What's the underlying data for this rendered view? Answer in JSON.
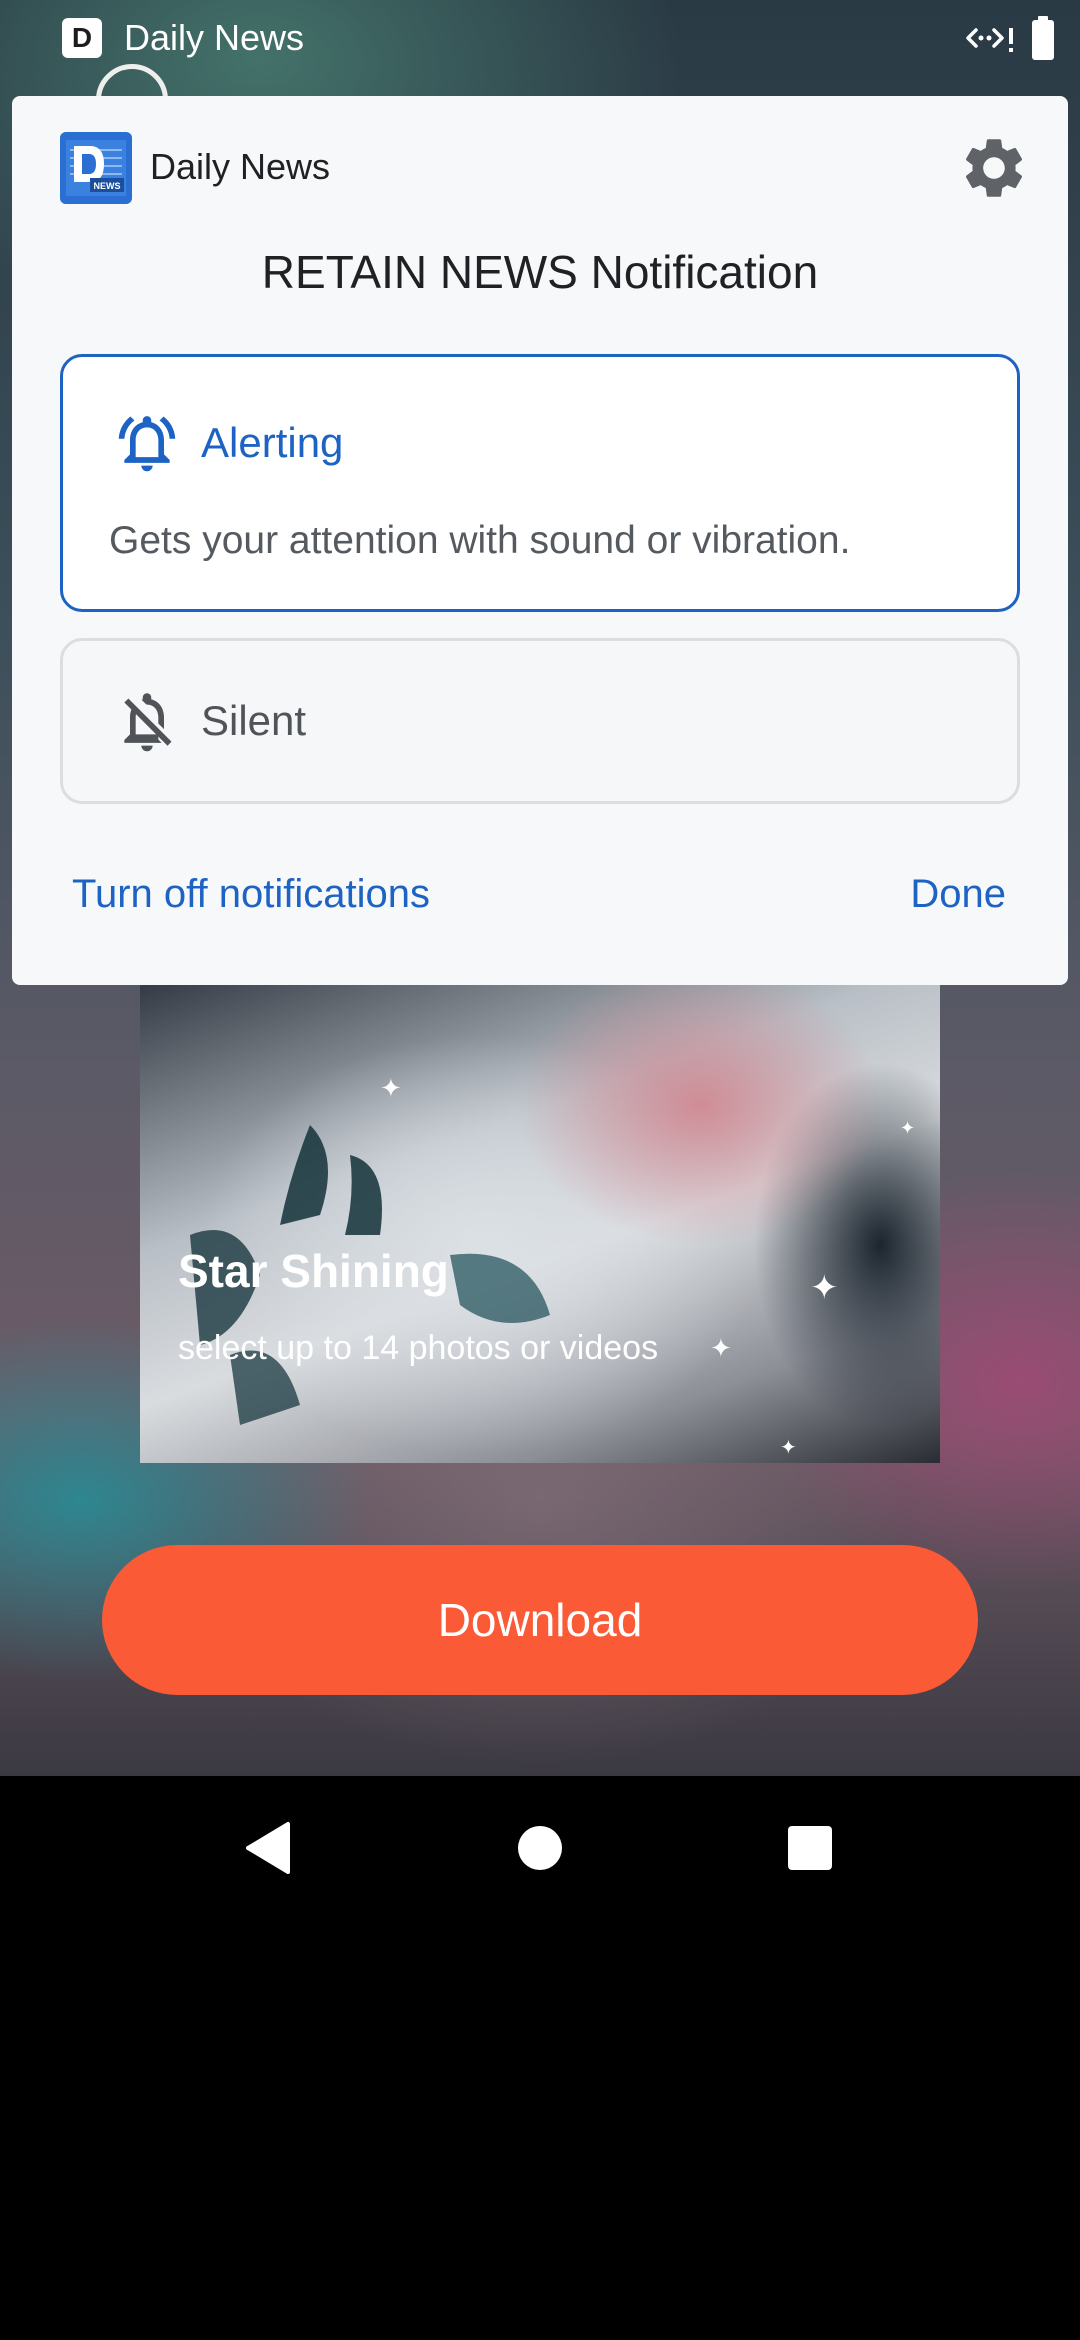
{
  "status_bar": {
    "app_icon_letter": "D",
    "app_name": "Daily News",
    "icons": [
      "data-arrows-icon",
      "battery-icon"
    ]
  },
  "panel": {
    "app_name": "Daily News",
    "app_icon_text": "NEWS",
    "title": "RETAIN NEWS Notification",
    "settings_icon": "gear-icon",
    "options": {
      "alerting": {
        "label": "Alerting",
        "description": "Gets your attention with sound or vibration.",
        "icon": "bell-ringing-icon",
        "selected": true
      },
      "silent": {
        "label": "Silent",
        "icon": "bell-off-icon",
        "selected": false
      }
    },
    "turn_off_label": "Turn off notifications",
    "done_label": "Done"
  },
  "ad": {
    "title": "Star Shining",
    "subtitle": "select up to 14 photos or videos",
    "download_label": "Download",
    "download_color": "#fa5a35"
  },
  "colors": {
    "accent": "#1d63c4",
    "panel_bg": "#f7f8fa"
  },
  "nav_bar": {
    "icons": [
      "back-icon",
      "home-icon",
      "recents-icon"
    ]
  }
}
